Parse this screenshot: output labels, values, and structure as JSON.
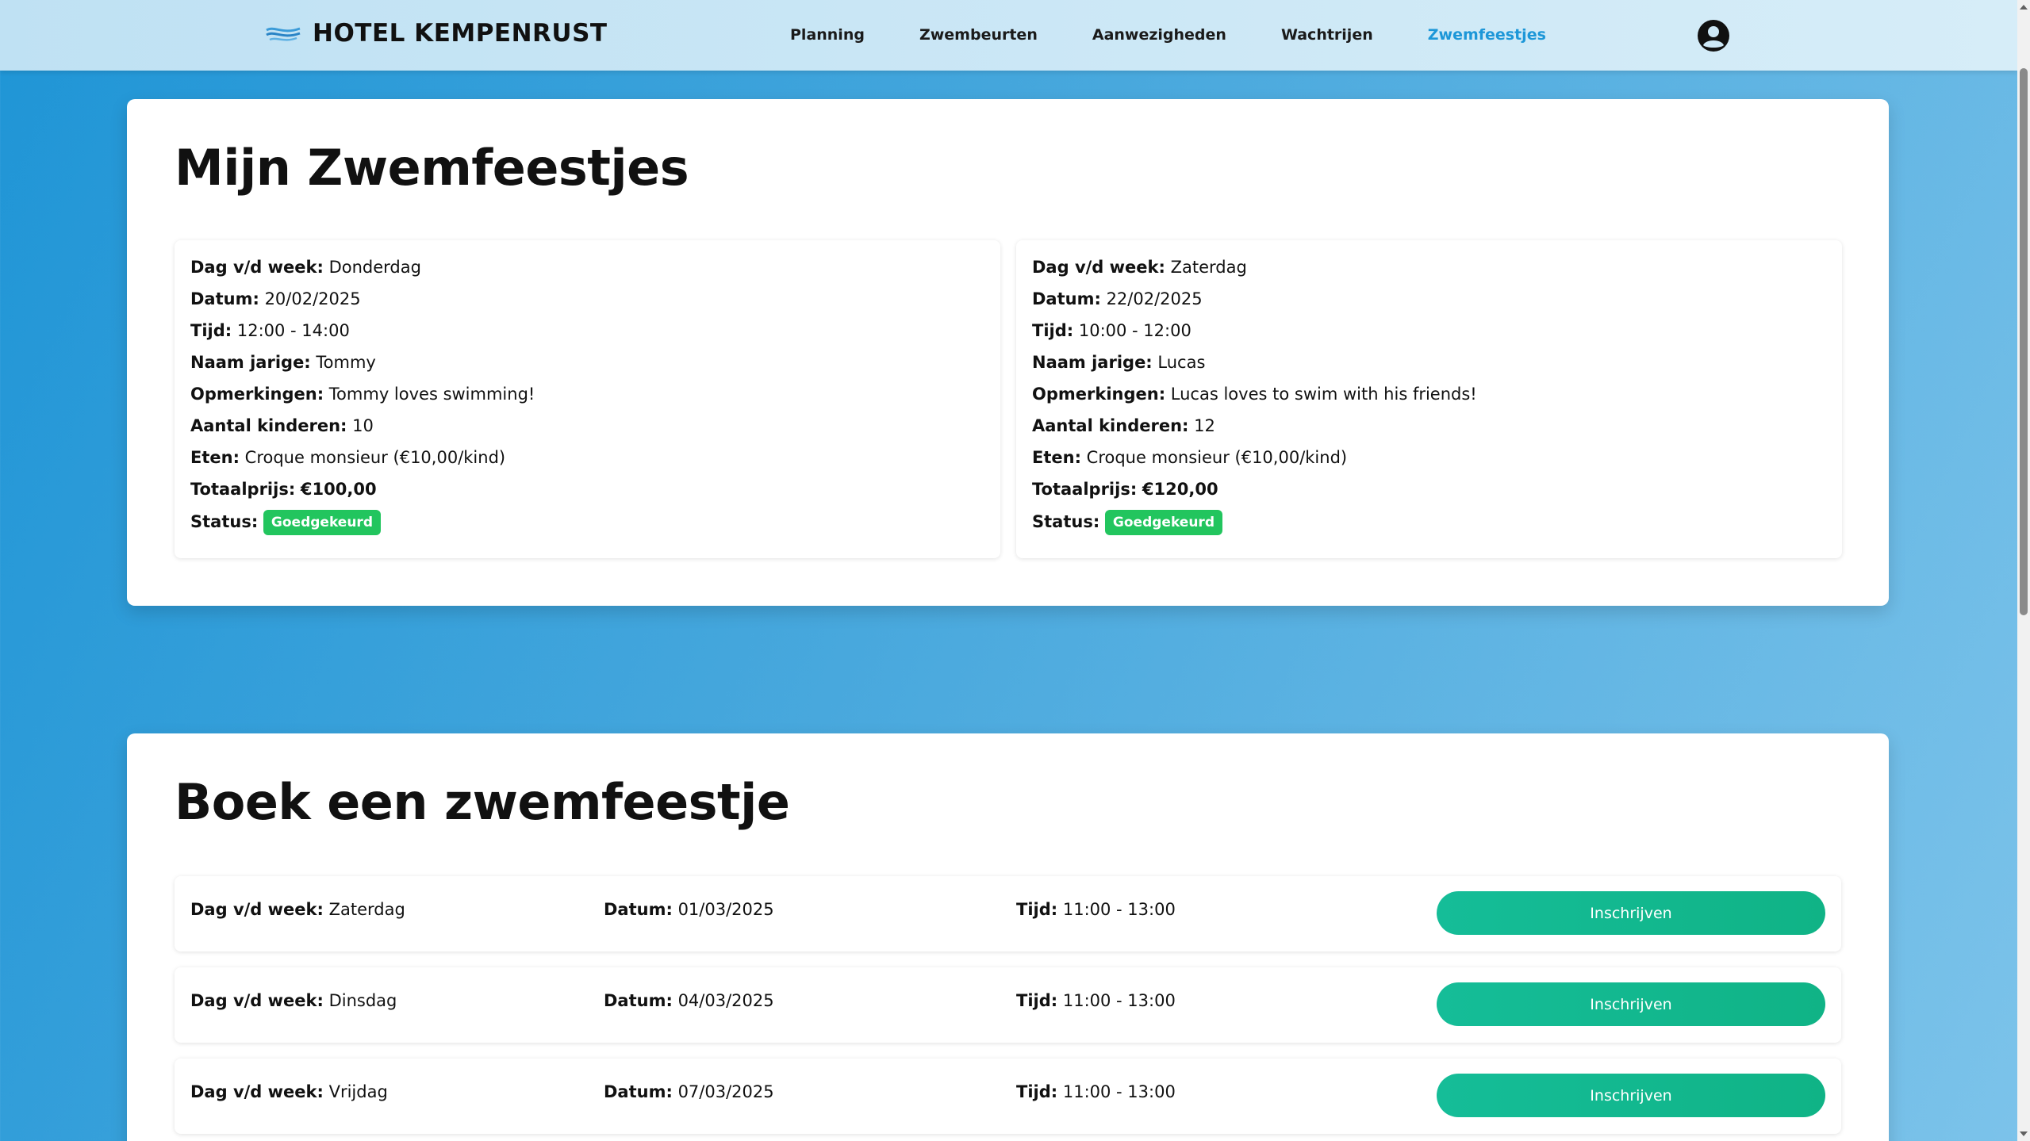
{
  "navbar": {
    "brand": "HOTEL KEMPENRUST",
    "links": [
      "Planning",
      "Zwembeurten",
      "Aanwezigheden",
      "Wachtrijen",
      "Zwemfeestjes"
    ],
    "active_link": "Zwemfeestjes",
    "user_icon": "user-circle-icon"
  },
  "my_parties": {
    "title": "Mijn Zwemfeestjes",
    "labels": {
      "day": "Dag v/d week:",
      "date": "Datum:",
      "time": "Tijd:",
      "name": "Naam jarige:",
      "remarks": "Opmerkingen:",
      "children": "Aantal kinderen:",
      "food": "Eten:",
      "total": "Totaalprijs:",
      "status": "Status:"
    },
    "items": [
      {
        "day": "Donderdag",
        "date": "20/02/2025",
        "time": "12:00 - 14:00",
        "name": "Tommy",
        "remarks": "Tommy loves swimming!",
        "children": "10",
        "food": "Croque monsieur (€10,00/kind)",
        "total": "€100,00",
        "status": "Goedgekeurd"
      },
      {
        "day": "Zaterdag",
        "date": "22/02/2025",
        "time": "10:00 - 12:00",
        "name": "Lucas",
        "remarks": "Lucas loves to swim with his friends!",
        "children": "12",
        "food": "Croque monsieur (€10,00/kind)",
        "total": "€120,00",
        "status": "Goedgekeurd"
      }
    ]
  },
  "book_party": {
    "title": "Boek een zwemfeestje",
    "labels": {
      "day": "Dag v/d week:",
      "date": "Datum:",
      "time": "Tijd:"
    },
    "button_label": "Inschrijven",
    "slots": [
      {
        "day": "Zaterdag",
        "date": "01/03/2025",
        "time": "11:00 - 13:00"
      },
      {
        "day": "Dinsdag",
        "date": "04/03/2025",
        "time": "11:00 - 13:00"
      },
      {
        "day": "Vrijdag",
        "date": "07/03/2025",
        "time": "11:00 - 13:00"
      }
    ]
  },
  "colors": {
    "accent": "#1d97d8",
    "status_approved": "#22c55e",
    "button": "#10b386"
  }
}
